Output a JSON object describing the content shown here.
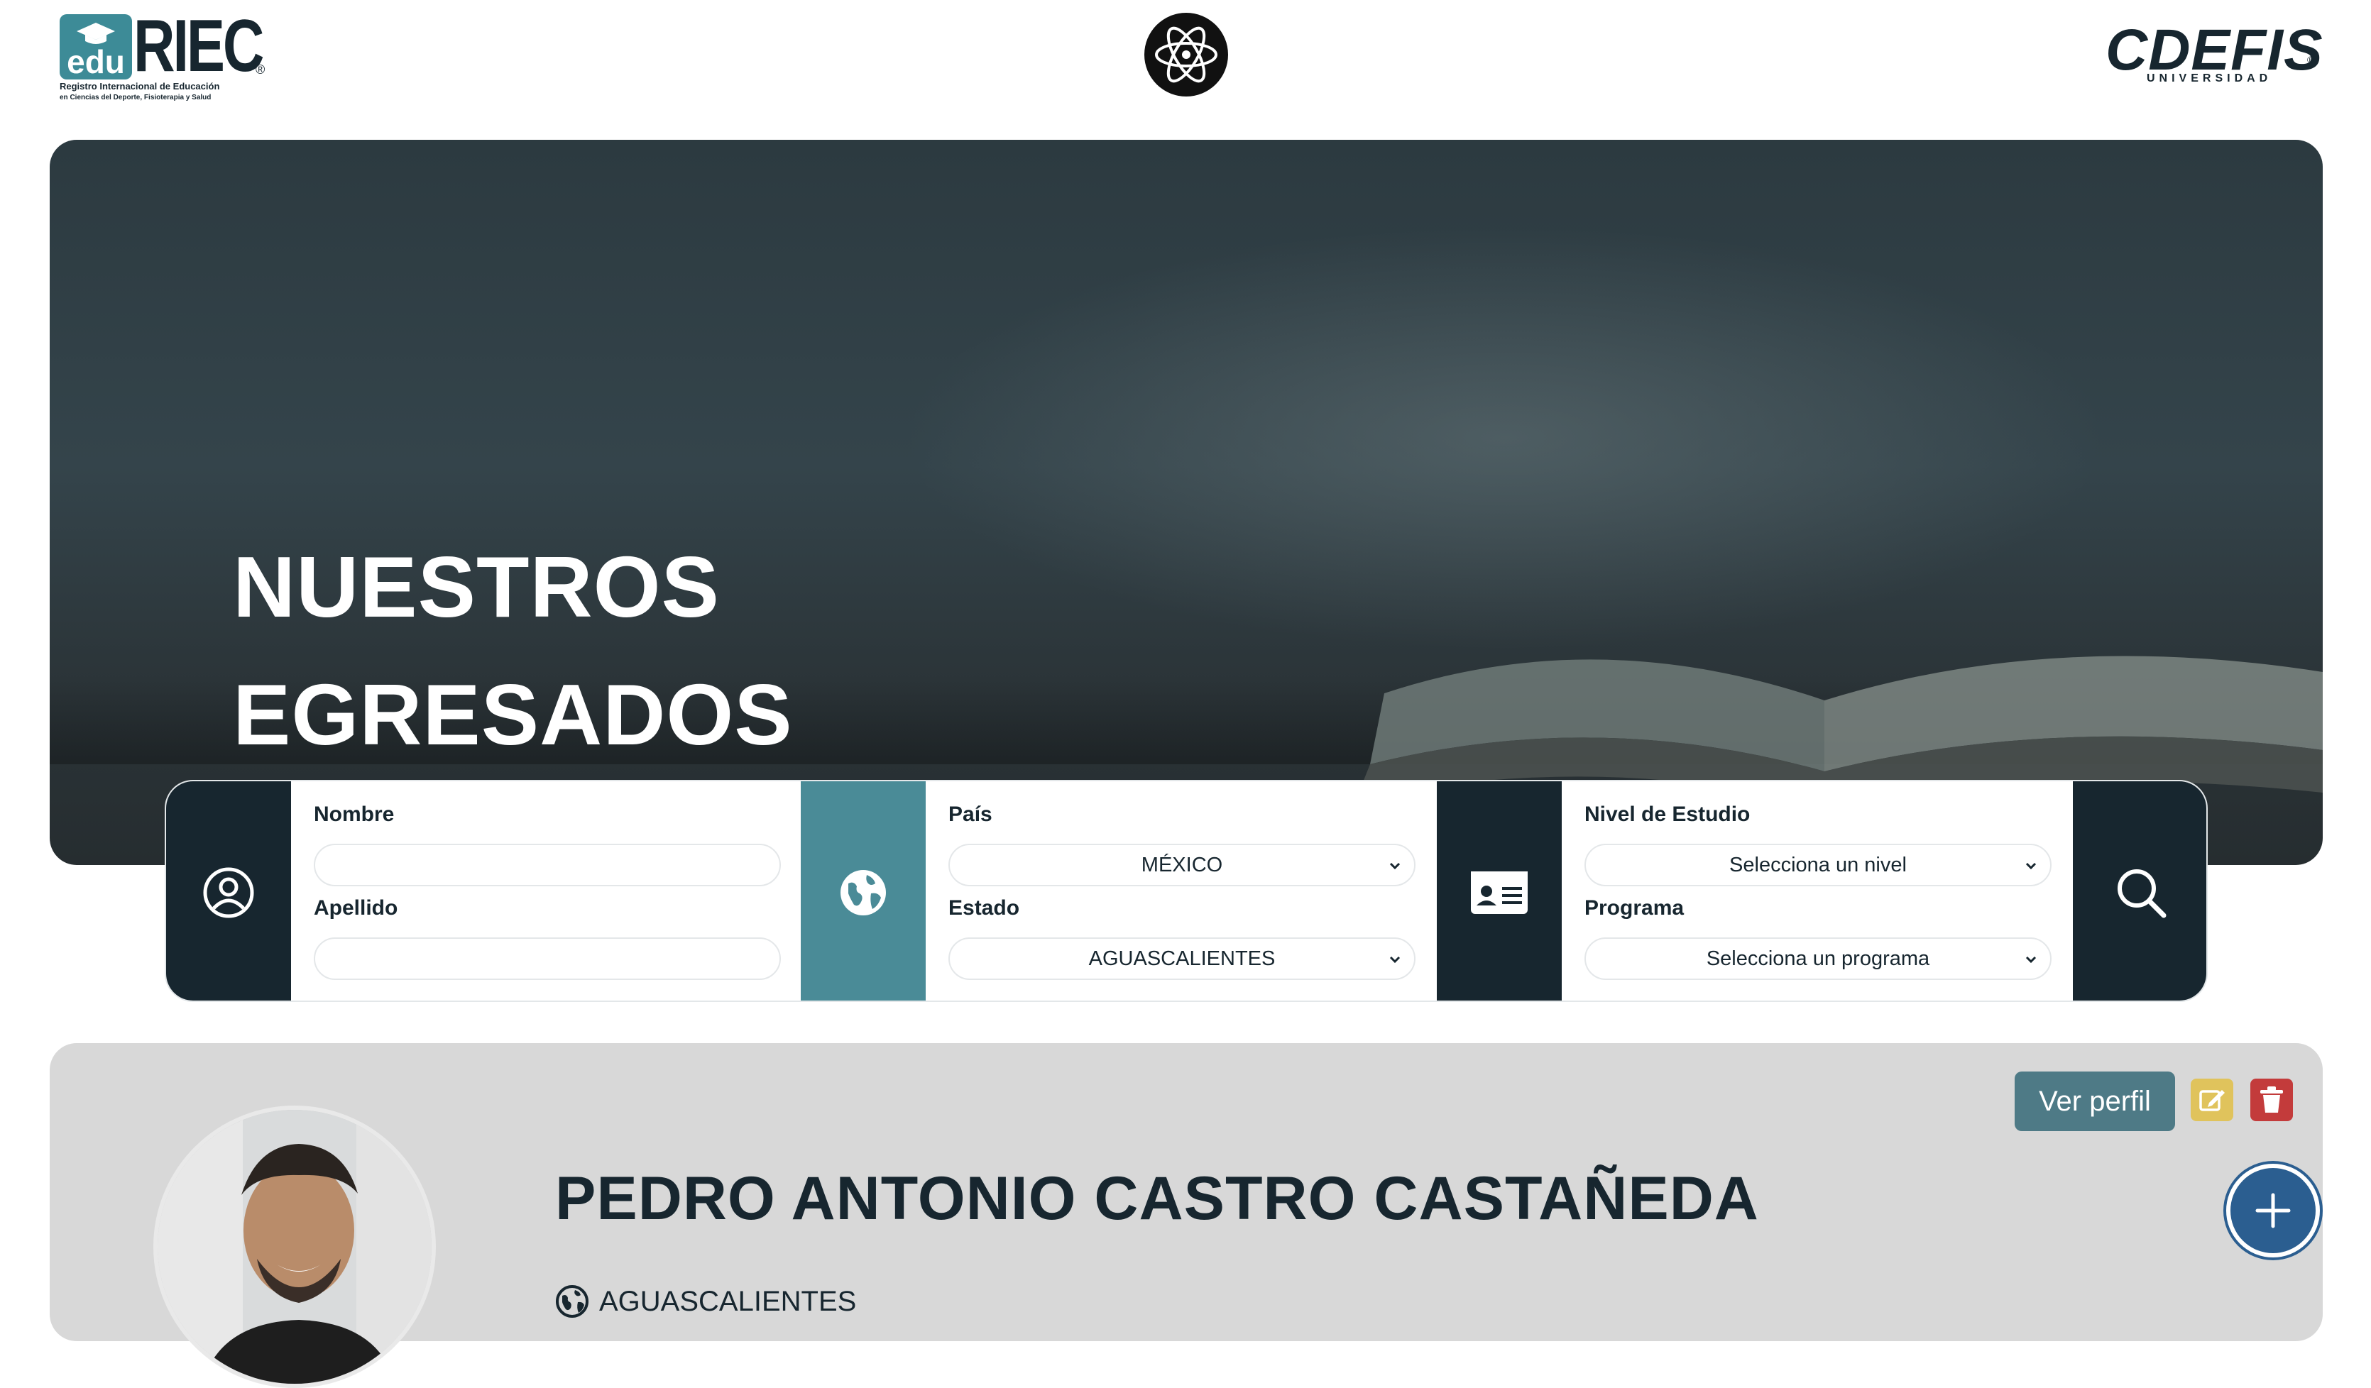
{
  "header": {
    "left_logo": {
      "badge": "edu",
      "name": "RIEC",
      "registered": "®",
      "subtitle_line1": "Registro Internacional de Educación",
      "subtitle_line2": "en Ciencias del Deporte, Fisioterapia y Salud"
    },
    "center_logo": {
      "icon": "atom-logo-icon"
    },
    "right_logo": {
      "name": "CDEFIS",
      "registered": "®",
      "subtitle": "UNIVERSIDAD"
    }
  },
  "hero": {
    "title_line1": "NUESTROS",
    "title_line2": "EGRESADOS"
  },
  "search": {
    "name_section": {
      "icon": "user-circle-icon",
      "nombre_label": "Nombre",
      "nombre_value": "",
      "apellido_label": "Apellido",
      "apellido_value": ""
    },
    "location_section": {
      "icon": "globe-icon",
      "pais_label": "País",
      "pais_value": "MÉXICO",
      "estado_label": "Estado",
      "estado_value": "AGUASCALIENTES"
    },
    "study_section": {
      "icon": "id-card-icon",
      "nivel_label": "Nivel de Estudio",
      "nivel_value": "Selecciona un nivel",
      "programa_label": "Programa",
      "programa_value": "Selecciona un programa"
    },
    "search_button_icon": "search-icon"
  },
  "results": [
    {
      "name": "PEDRO ANTONIO CASTRO CASTAÑEDA",
      "location": "AGUASCALIENTES",
      "ver_perfil_label": "Ver perfil",
      "edit_icon": "edit-icon",
      "delete_icon": "trash-icon"
    }
  ],
  "fab_icon": "plus-icon",
  "colors": {
    "navy": "#17262f",
    "teal": "#4a8b97",
    "card_bg": "#d8d8d8",
    "ver_perfil_bg": "#4e7a86",
    "edit_bg": "#e0c35c",
    "delete_bg": "#c33b3b",
    "fab_bg": "#2b5e90"
  }
}
